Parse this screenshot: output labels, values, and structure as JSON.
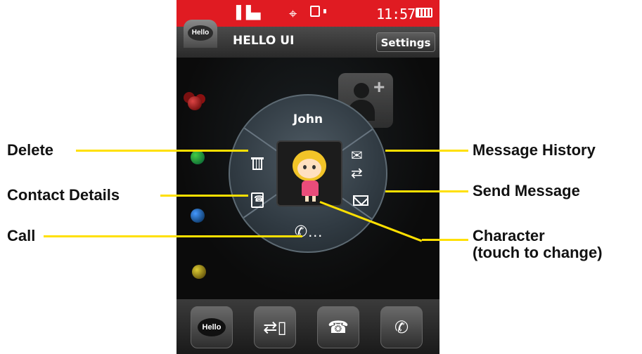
{
  "status_bar": {
    "time": "11:57"
  },
  "header": {
    "hello_tab_label": "Hello",
    "title": "HELLO UI",
    "settings_label": "Settings"
  },
  "radial_menu": {
    "contact_name": "John"
  },
  "bottom_bar": {
    "hello_label": "Hello"
  },
  "annotations": {
    "delete": "Delete",
    "contact_details": "Contact Details",
    "call": "Call",
    "message_history": "Message History",
    "send_message": "Send Message",
    "character_line1": "Character",
    "character_line2": "(touch to change)"
  },
  "colors": {
    "status_bar": "#e01b22",
    "callout_line": "#ffe000"
  }
}
